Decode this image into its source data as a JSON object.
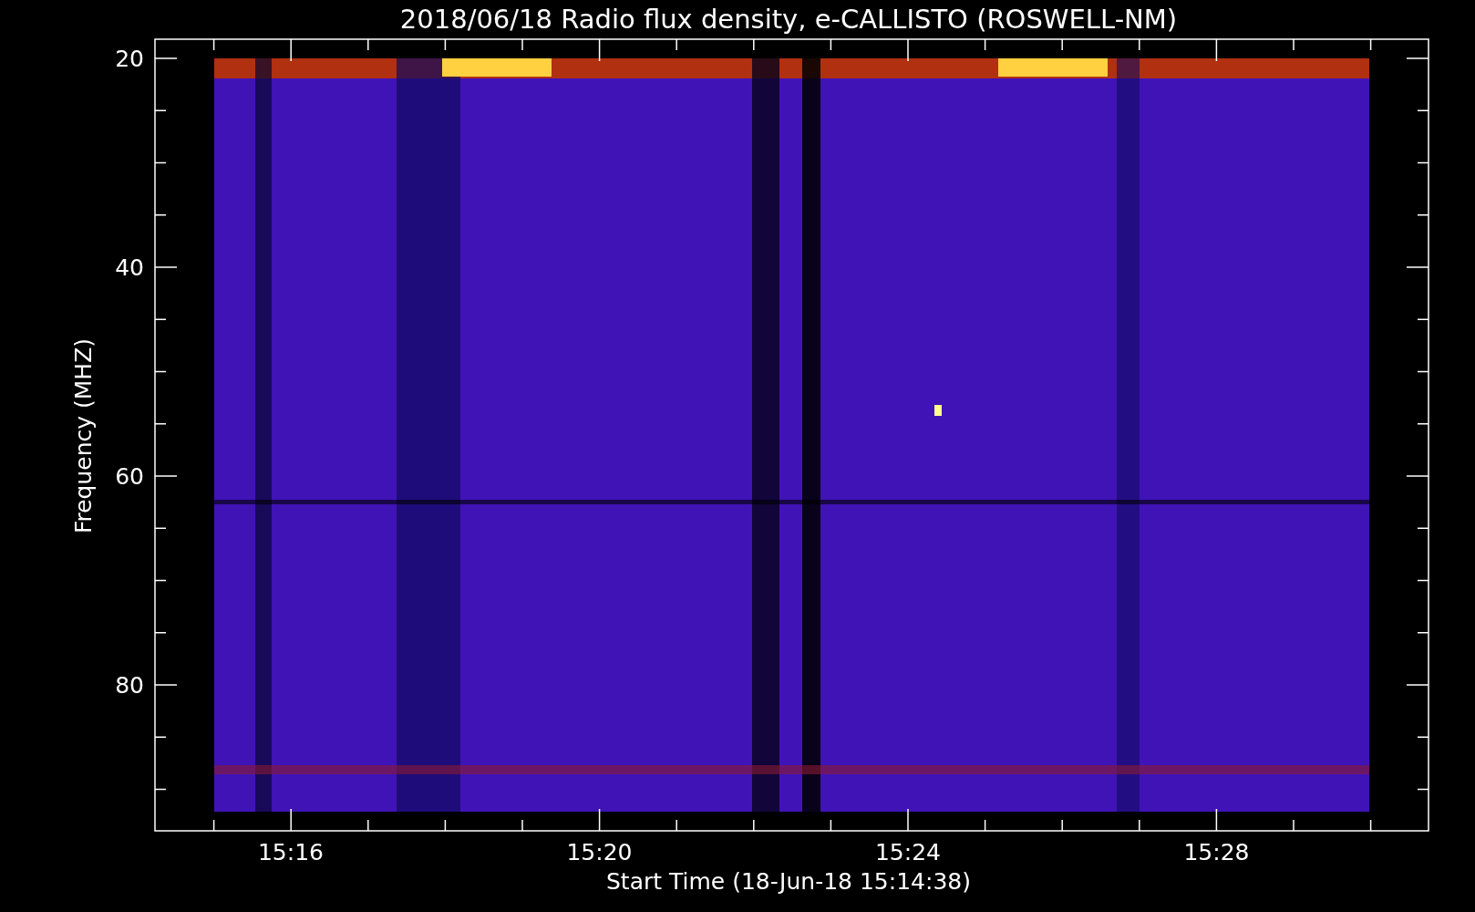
{
  "title": "2018/06/18  Radio flux density, e-CALLISTO (ROSWELL-NM)",
  "y_axis": {
    "label": "Frequency (MHZ)",
    "ticks": [
      "20",
      "40",
      "60",
      "80"
    ]
  },
  "x_axis": {
    "label": "Start Time (18-Jun-18 15:14:38)",
    "ticks": [
      "15:16",
      "15:20",
      "15:24",
      "15:28"
    ]
  }
}
